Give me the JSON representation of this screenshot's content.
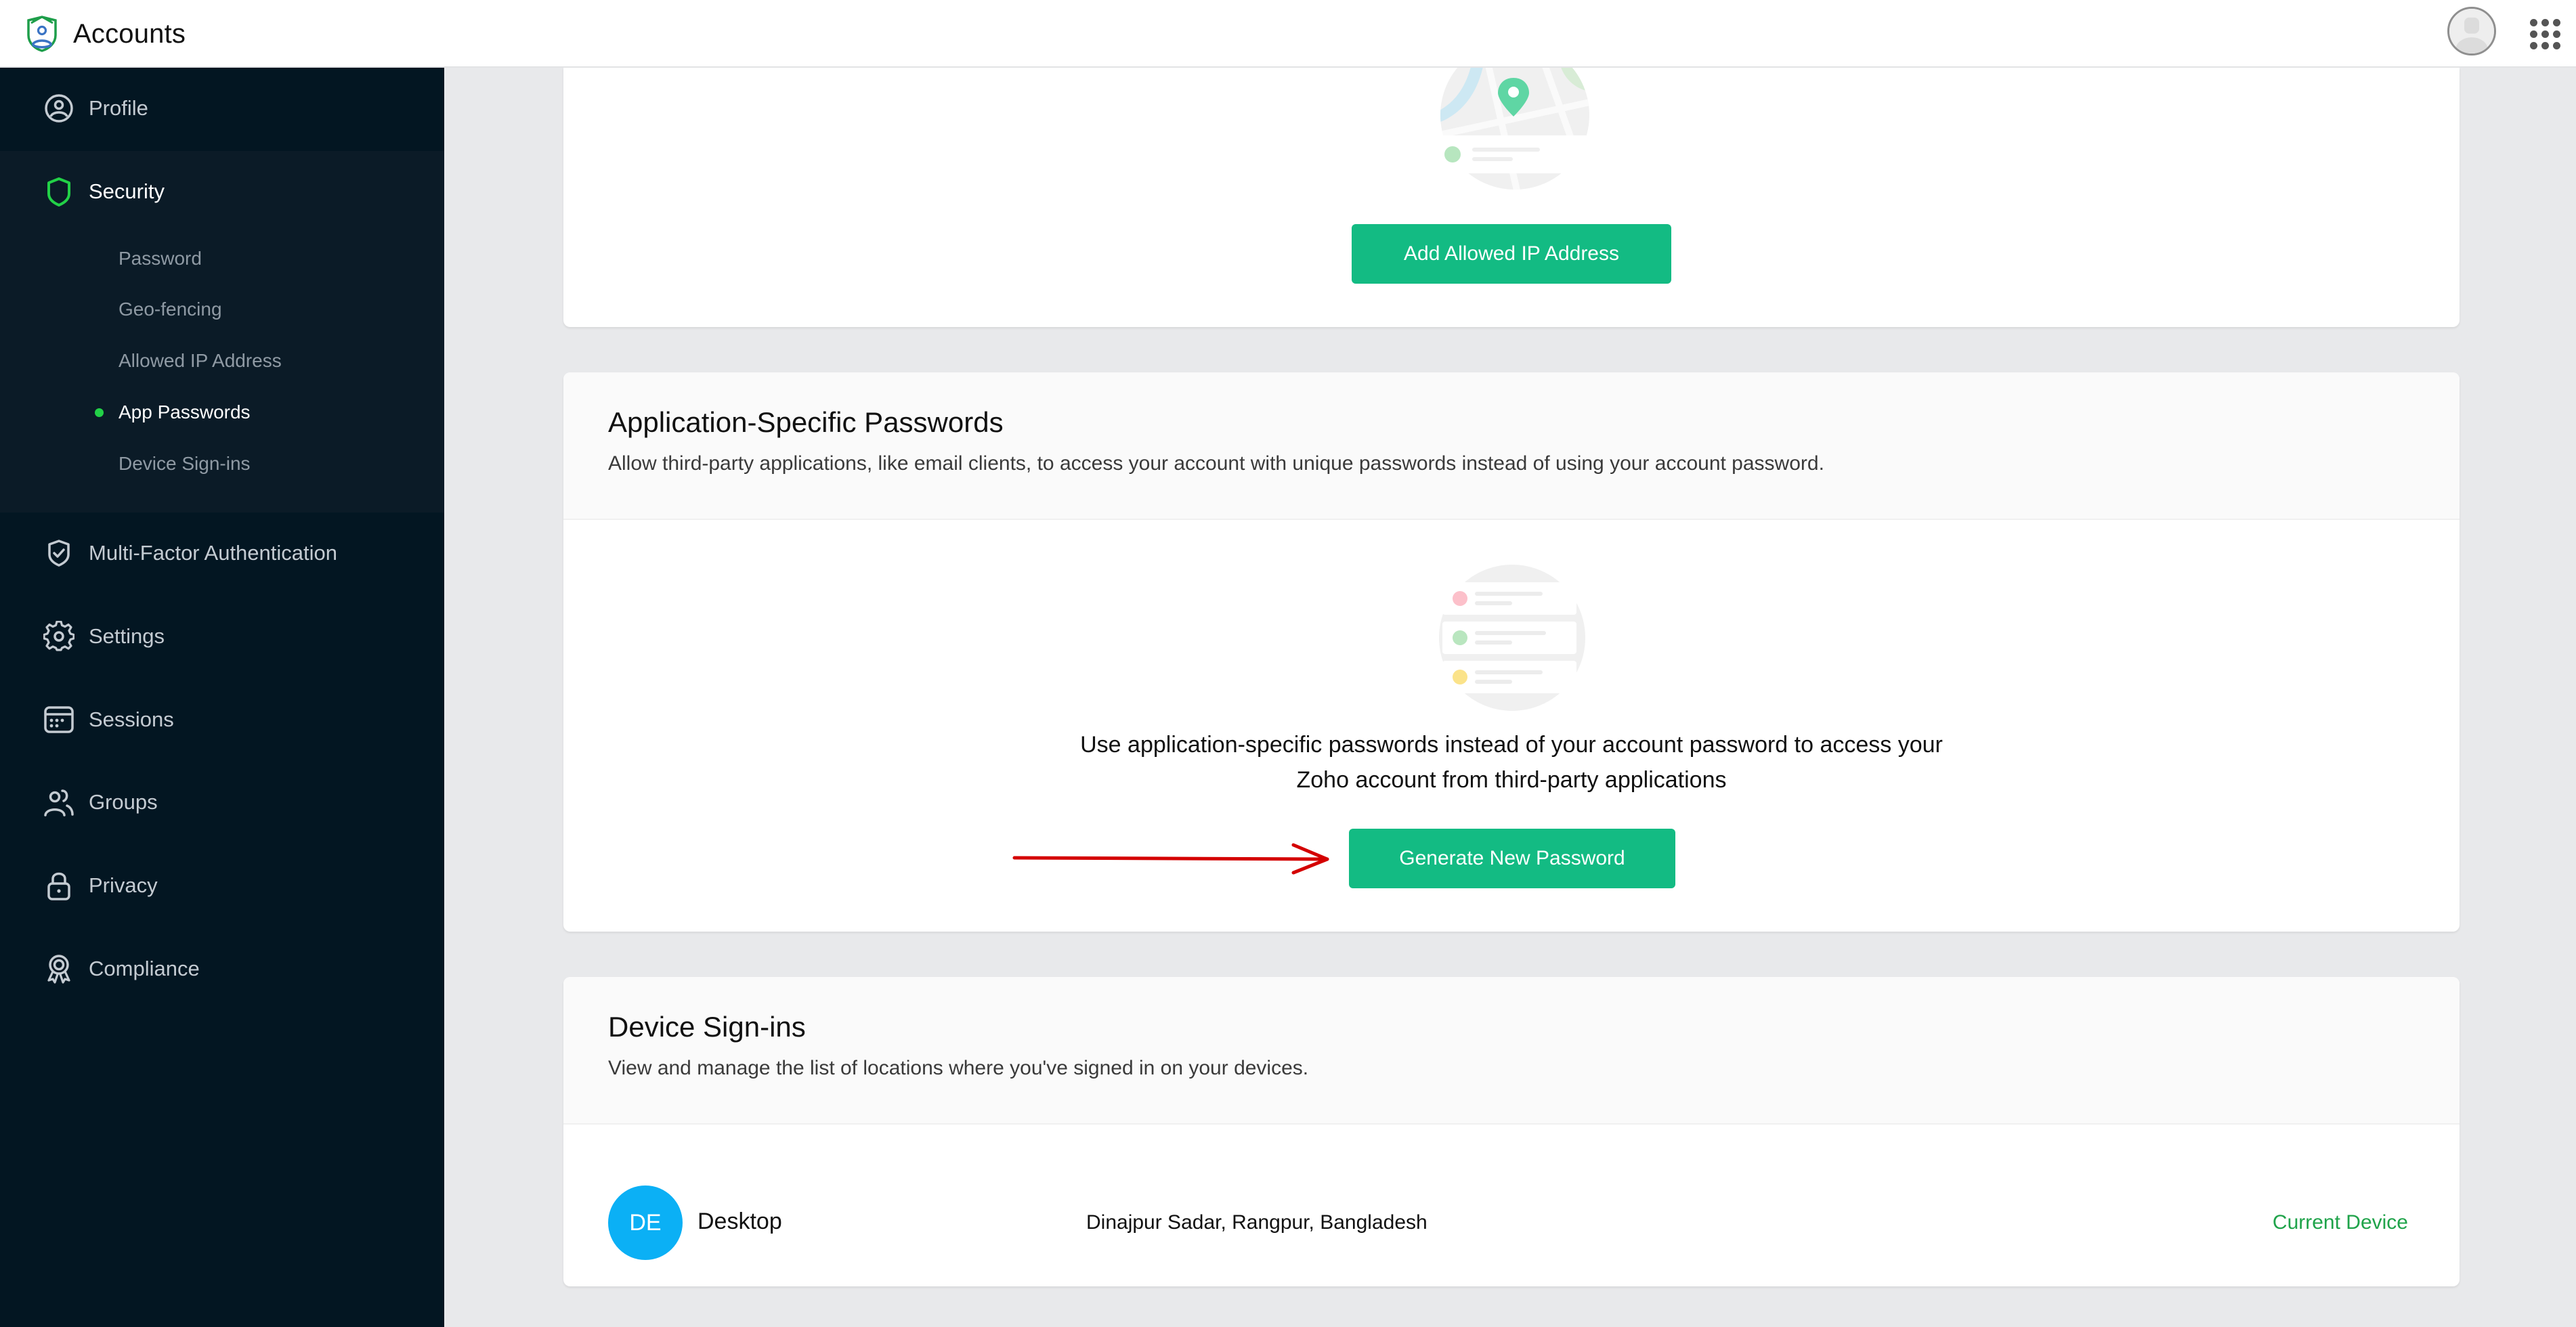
{
  "app": {
    "title": "Accounts",
    "logo_icon": "accounts-shield-user-icon",
    "avatar_icon": "user-avatar-icon",
    "apps_icon": "app-grid-icon"
  },
  "sidebar": {
    "items": [
      {
        "label": "Profile",
        "icon": "user-circle-icon",
        "active": false
      },
      {
        "label": "Security",
        "icon": "shield-icon",
        "active": true
      },
      {
        "label": "Multi-Factor Authentication",
        "icon": "shield-check-icon",
        "active": false
      },
      {
        "label": "Settings",
        "icon": "gear-icon",
        "active": false
      },
      {
        "label": "Sessions",
        "icon": "calendar-icon",
        "active": false
      },
      {
        "label": "Groups",
        "icon": "users-icon",
        "active": false
      },
      {
        "label": "Privacy",
        "icon": "lock-icon",
        "active": false
      },
      {
        "label": "Compliance",
        "icon": "award-badge-icon",
        "active": false
      }
    ],
    "security_subitems": [
      {
        "label": "Password",
        "active": false
      },
      {
        "label": "Geo-fencing",
        "active": false
      },
      {
        "label": "Allowed IP Address",
        "active": false
      },
      {
        "label": "App Passwords",
        "active": true
      },
      {
        "label": "Device Sign-ins",
        "active": false
      }
    ]
  },
  "allowed_ip": {
    "illustration": "map-location-pin-illustration",
    "button_label": "Add Allowed IP Address"
  },
  "app_passwords": {
    "title": "Application-Specific Passwords",
    "description": "Allow third-party applications, like email clients, to access your account with unique passwords instead of using your account password.",
    "illustration": "password-list-illustration",
    "body_line1": "Use application-specific passwords instead of your account password to access your",
    "body_line2": "Zoho account from third-party applications",
    "button_label": "Generate New Password",
    "annotation": "red-arrow-pointing-to-button"
  },
  "device_signins": {
    "title": "Device Sign-ins",
    "description": "View and manage the list of locations where you've signed in on your devices.",
    "devices": [
      {
        "initials": "DE",
        "name": "Desktop",
        "location": "Dinajpur Sadar, Rangpur, Bangladesh",
        "status": "Current Device"
      }
    ]
  },
  "colors": {
    "accent_green": "#13bb83",
    "sidebar_bg": "#031622",
    "active_dot": "#22d147",
    "device_avatar": "#0bb0f5",
    "current_device_text": "#1fa34a",
    "annotation_red": "#d40000"
  }
}
